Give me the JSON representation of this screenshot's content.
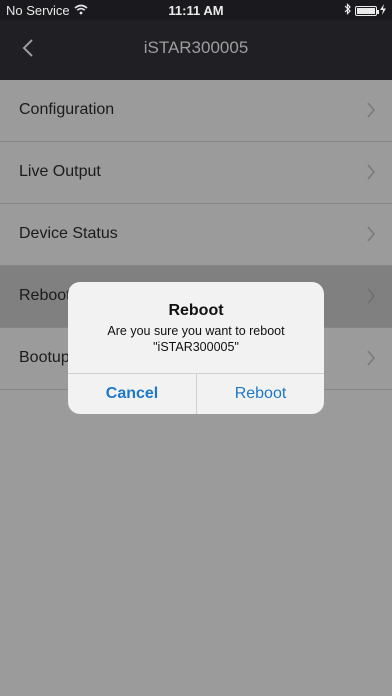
{
  "status_bar": {
    "carrier": "No Service",
    "time": "11:11 AM"
  },
  "nav": {
    "title": "iSTAR300005"
  },
  "menu": {
    "items": [
      {
        "label": "Configuration"
      },
      {
        "label": "Live Output"
      },
      {
        "label": "Device Status"
      },
      {
        "label": "Reboot"
      },
      {
        "label": "Bootup"
      }
    ]
  },
  "alert": {
    "title": "Reboot",
    "message_line1": "Are you sure you want to reboot",
    "message_line2": "\"iSTAR300005\"",
    "cancel_label": "Cancel",
    "confirm_label": "Reboot"
  },
  "colors": {
    "accent": "#1e78c8",
    "overlay": "#9b9b9b",
    "nav_background": "#1f1f24"
  }
}
